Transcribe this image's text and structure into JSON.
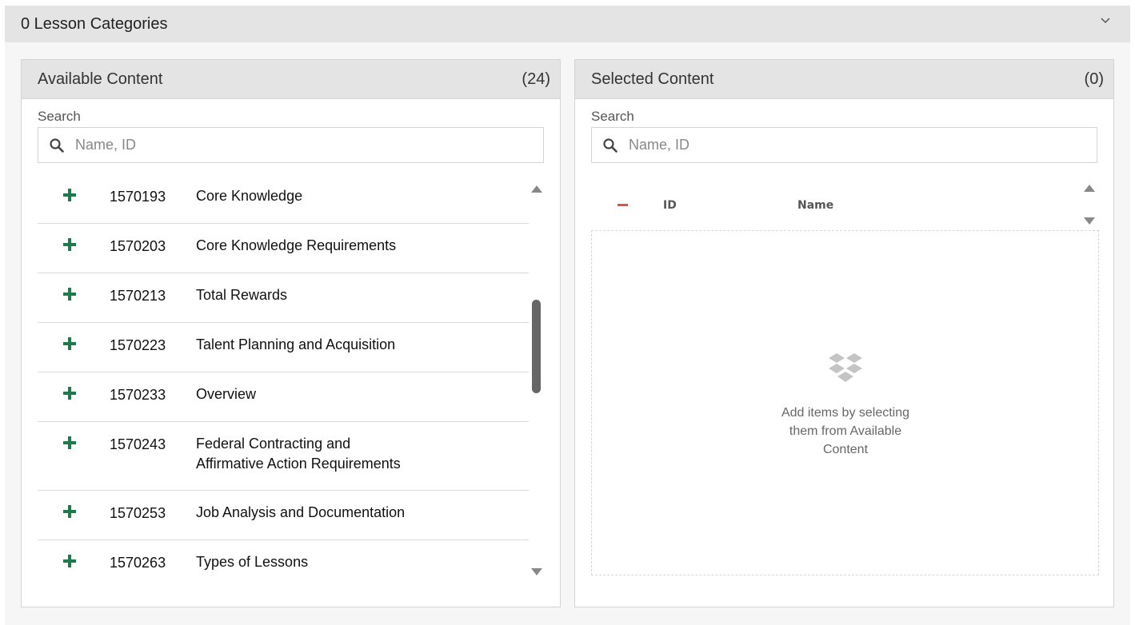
{
  "header": {
    "title": "0 Lesson Categories",
    "icon": "chevron-down-icon"
  },
  "available": {
    "title": "Available Content",
    "count": "(24)",
    "search_label": "Search",
    "search_placeholder": "Name, ID",
    "items": [
      {
        "id": "1570193",
        "name": "Core Knowledge"
      },
      {
        "id": "1570203",
        "name": "Core Knowledge Requirements"
      },
      {
        "id": "1570213",
        "name": "Total Rewards"
      },
      {
        "id": "1570223",
        "name": "Talent Planning and Acquisition"
      },
      {
        "id": "1570233",
        "name": "Overview"
      },
      {
        "id": "1570243",
        "name": "Federal Contracting and Affirmative Action Requirements"
      },
      {
        "id": "1570253",
        "name": "Job Analysis and Documentation"
      },
      {
        "id": "1570263",
        "name": "Types of Lessons"
      }
    ]
  },
  "selected": {
    "title": "Selected Content",
    "count": "(0)",
    "search_label": "Search",
    "search_placeholder": "Name, ID",
    "col_id": "ID",
    "col_name": "Name",
    "empty_message": "Add items by selecting them from Available Content"
  },
  "colors": {
    "add": "#1e7a4a",
    "remove": "#d9534f",
    "header_bg": "#e4e4e4"
  }
}
